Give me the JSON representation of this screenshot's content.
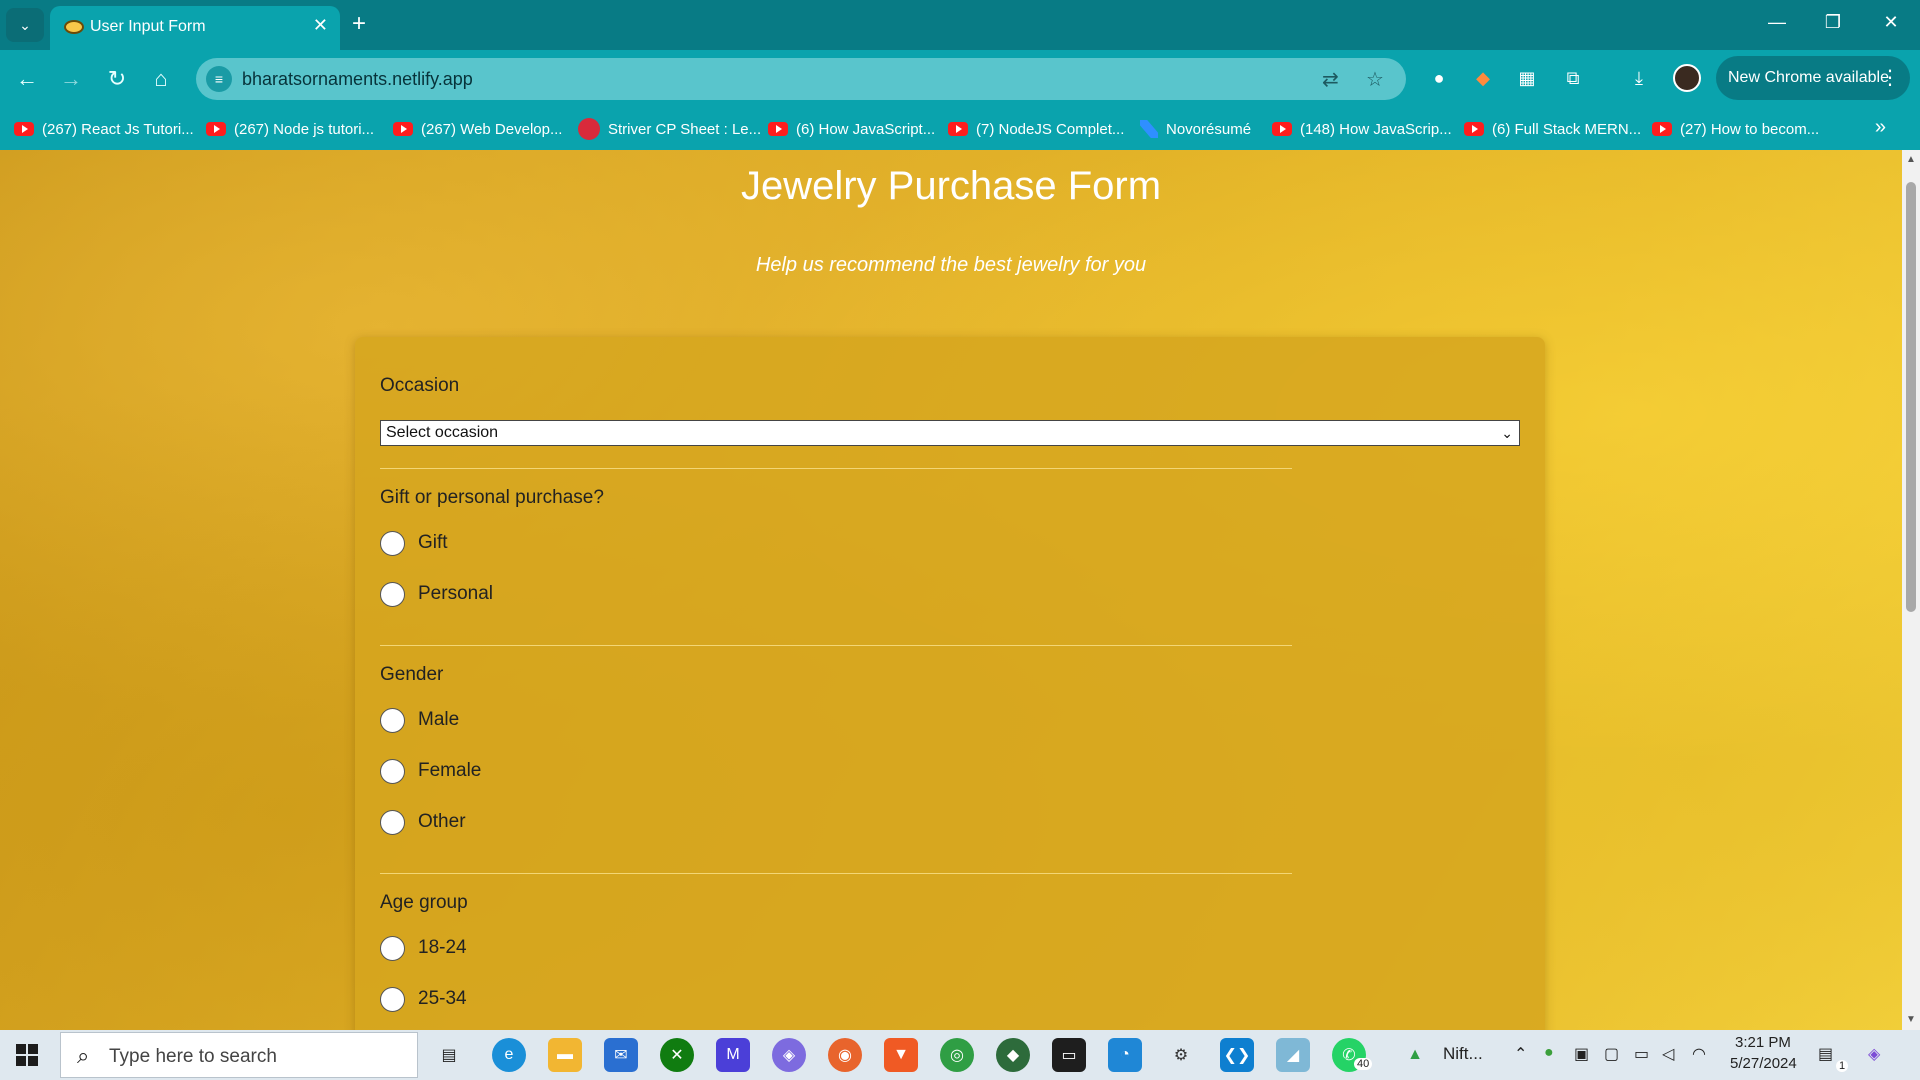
{
  "browser": {
    "tab_title": "User Input Form",
    "url": "bharatsornaments.netlify.app",
    "update_label": "New Chrome available",
    "bookmarks": [
      {
        "label": "(267) React Js Tutori...",
        "icon": "youtube-icon"
      },
      {
        "label": "(267) Node js tutori...",
        "icon": "youtube-icon"
      },
      {
        "label": "(267) Web Develop...",
        "icon": "youtube-icon"
      },
      {
        "label": "Striver CP Sheet : Le...",
        "icon": "tuf-icon"
      },
      {
        "label": "(6) How JavaScript...",
        "icon": "youtube-icon"
      },
      {
        "label": "(7) NodeJS Complet...",
        "icon": "youtube-icon"
      },
      {
        "label": "Novorésumé",
        "icon": "novoresume-icon"
      },
      {
        "label": "(148) How JavaScrip...",
        "icon": "youtube-icon"
      },
      {
        "label": "(6) Full Stack MERN...",
        "icon": "youtube-icon"
      },
      {
        "label": "(27) How to becom...",
        "icon": "youtube-icon"
      }
    ]
  },
  "page": {
    "title": "Jewelry Purchase Form",
    "subtitle": "Help us recommend the best jewelry for you"
  },
  "form": {
    "occasion": {
      "label": "Occasion",
      "selected": "Select occasion"
    },
    "purpose": {
      "label": "Gift or personal purchase?",
      "options": [
        "Gift",
        "Personal"
      ]
    },
    "gender": {
      "label": "Gender",
      "options": [
        "Male",
        "Female",
        "Other"
      ]
    },
    "age": {
      "label": "Age group",
      "options": [
        "18-24",
        "25-34"
      ]
    }
  },
  "taskbar": {
    "search_placeholder": "Type here to search",
    "pinned_label": "Nift...",
    "whatsapp_badge": "40",
    "notification_badge": "1",
    "time": "3:21 PM",
    "date": "5/27/2024"
  },
  "colors": {
    "chrome_teal": "#087b85",
    "toolbar_teal": "#0aa3ad",
    "page_gold": "#d9a81e"
  }
}
